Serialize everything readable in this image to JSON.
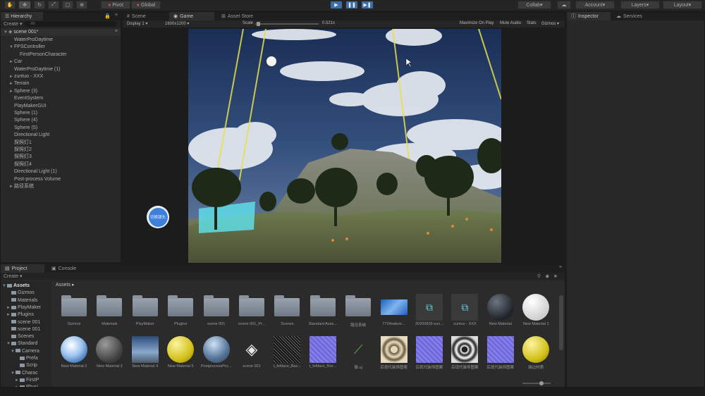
{
  "toolbar": {
    "pivot": "Pivot",
    "global": "Global",
    "collab": "Collab",
    "account": "Account",
    "layers": "Layers",
    "layout": "Layout"
  },
  "hierarchy": {
    "tab": "Hierarchy",
    "create": "Create",
    "search_placeholder": "All",
    "scene": "scene 001*",
    "items": [
      {
        "label": "WaterProDaytime",
        "indent": 1,
        "arrow": ""
      },
      {
        "label": "FPSController",
        "indent": 1,
        "arrow": "▼"
      },
      {
        "label": "FirstPersonCharacter",
        "indent": 2,
        "arrow": ""
      },
      {
        "label": "Car",
        "indent": 1,
        "arrow": "►"
      },
      {
        "label": "WaterProDaytime (1)",
        "indent": 1,
        "arrow": ""
      },
      {
        "label": "zuntuo - XXX",
        "indent": 1,
        "arrow": "►"
      },
      {
        "label": "Terrain",
        "indent": 1,
        "arrow": "►"
      },
      {
        "label": "Sphere (3)",
        "indent": 1,
        "arrow": "►"
      },
      {
        "label": "EventSystem",
        "indent": 1,
        "arrow": ""
      },
      {
        "label": "PlayMakerGUI",
        "indent": 1,
        "arrow": ""
      },
      {
        "label": "Sphere (1)",
        "indent": 1,
        "arrow": ""
      },
      {
        "label": "Sphere (4)",
        "indent": 1,
        "arrow": ""
      },
      {
        "label": "Sphere (5)",
        "indent": 1,
        "arrow": ""
      },
      {
        "label": "Directional Light",
        "indent": 1,
        "arrow": ""
      },
      {
        "label": "探照灯1",
        "indent": 1,
        "arrow": ""
      },
      {
        "label": "探照灯2",
        "indent": 1,
        "arrow": ""
      },
      {
        "label": "探照灯3",
        "indent": 1,
        "arrow": ""
      },
      {
        "label": "探照灯4",
        "indent": 1,
        "arrow": ""
      },
      {
        "label": "Directional Light (1)",
        "indent": 1,
        "arrow": ""
      },
      {
        "label": "Post-process Volume",
        "indent": 1,
        "arrow": ""
      },
      {
        "label": "路径系统",
        "indent": 1,
        "arrow": "►"
      }
    ]
  },
  "center_tabs": {
    "scene": "Scene",
    "game": "Game",
    "asset_store": "Asset Store"
  },
  "game_bar": {
    "display": "Display 1",
    "resolution": "1600x1200",
    "scale_label": "Scale",
    "scale_value": "0.521x",
    "maximize": "Maximize On Play",
    "mute": "Mute Audio",
    "stats": "Stats",
    "gizmos": "Gizmos"
  },
  "game_overlay_button": "切换镜头",
  "right_tabs": {
    "inspector": "Inspector",
    "services": "Services"
  },
  "bottom_tabs": {
    "project": "Project",
    "console": "Console"
  },
  "project": {
    "create": "Create",
    "breadcrumb": "Assets",
    "tree": [
      {
        "label": "Assets",
        "indent": 0,
        "arrow": "▼",
        "bold": true
      },
      {
        "label": "Gizmos",
        "indent": 1,
        "arrow": ""
      },
      {
        "label": "Materials",
        "indent": 1,
        "arrow": ""
      },
      {
        "label": "PlayMaker",
        "indent": 1,
        "arrow": "►"
      },
      {
        "label": "Plugins",
        "indent": 1,
        "arrow": "►"
      },
      {
        "label": "scene 001",
        "indent": 1,
        "arrow": ""
      },
      {
        "label": "scene 001",
        "indent": 1,
        "arrow": ""
      },
      {
        "label": "Scenes",
        "indent": 1,
        "arrow": ""
      },
      {
        "label": "Standard",
        "indent": 1,
        "arrow": "▼"
      },
      {
        "label": "Camera",
        "indent": 2,
        "arrow": "▼"
      },
      {
        "label": "Prefa",
        "indent": 3,
        "arrow": ""
      },
      {
        "label": "Scrip",
        "indent": 3,
        "arrow": ""
      },
      {
        "label": "Charac",
        "indent": 2,
        "arrow": "▼"
      },
      {
        "label": "FirstP",
        "indent": 3,
        "arrow": "►"
      },
      {
        "label": "Physi",
        "indent": 3,
        "arrow": "►"
      }
    ],
    "row1": [
      {
        "label": "Gizmos",
        "kind": "folder"
      },
      {
        "label": "Materials",
        "kind": "folder"
      },
      {
        "label": "PlayMaker",
        "kind": "folder"
      },
      {
        "label": "Plugins",
        "kind": "folder"
      },
      {
        "label": "scene 001",
        "kind": "folder"
      },
      {
        "label": "scene 001_Pr...",
        "kind": "folder"
      },
      {
        "label": "Scenes",
        "kind": "folder"
      },
      {
        "label": "Standard Asse...",
        "kind": "folder"
      },
      {
        "label": "路径系统",
        "kind": "folder"
      },
      {
        "label": "7724nature...",
        "kind": "image"
      },
      {
        "label": "20200829-zun...",
        "kind": "model"
      },
      {
        "label": "zuntuo - XXX",
        "kind": "model"
      },
      {
        "label": "New Material",
        "kind": "sphere-dark"
      },
      {
        "label": "New Material 1",
        "kind": "sphere-white"
      }
    ],
    "row2": [
      {
        "label": "New Material 2",
        "kind": "sphere-sky"
      },
      {
        "label": "New Material 3",
        "kind": "sphere-grey"
      },
      {
        "label": "New Material 4",
        "kind": "sky-square"
      },
      {
        "label": "New Material 5",
        "kind": "sphere-yellow"
      },
      {
        "label": "PostprocessPro...",
        "kind": "sphere-glass"
      },
      {
        "label": "scene 001",
        "kind": "unity"
      },
      {
        "label": "t_feltlace_Bas...",
        "kind": "lace"
      },
      {
        "label": "t_feltlace_Nor...",
        "kind": "normal"
      },
      {
        "label": "像.uj",
        "kind": "script"
      },
      {
        "label": "后现代装饰图案",
        "kind": "pattern"
      },
      {
        "label": "后现代装饰图案",
        "kind": "normal"
      },
      {
        "label": "后现代装饰图案",
        "kind": "pattern2"
      },
      {
        "label": "后现代装饰图案",
        "kind": "normal"
      },
      {
        "label": "描边材质",
        "kind": "sphere-yellow"
      }
    ]
  }
}
